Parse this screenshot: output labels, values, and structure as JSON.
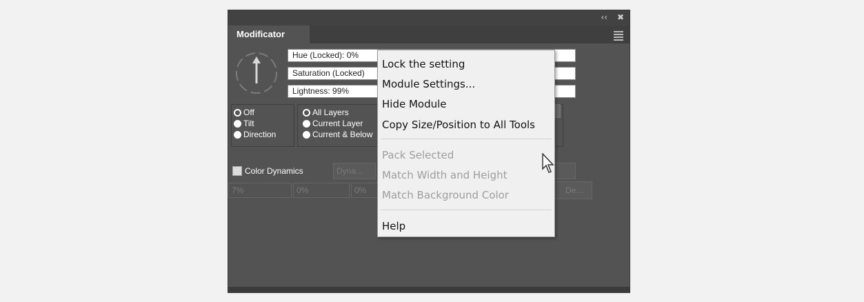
{
  "panel": {
    "title": "Modificator",
    "controls": {
      "collapse": "‹‹",
      "close": "✖"
    }
  },
  "fields": {
    "hue": "Hue (Locked): 0%",
    "saturation": "Saturation (Locked)",
    "lightness": "Lightness: 99%"
  },
  "mode_radios": [
    {
      "label": "Off",
      "selected": true
    },
    {
      "label": "Tilt",
      "selected": false
    },
    {
      "label": "Direction",
      "selected": false
    }
  ],
  "layer_radios": [
    {
      "label": "All Layers",
      "selected": true
    },
    {
      "label": "Current Layer",
      "selected": false
    },
    {
      "label": "Current & Below",
      "selected": false
    }
  ],
  "color_dynamics": {
    "label": "Color Dynamics",
    "checked": false
  },
  "disabled_controls": {
    "dyna_button": "Dyna...",
    "right_button": "De..."
  },
  "percent_boxes": [
    "7%",
    "0%",
    "0%"
  ],
  "context_menu": {
    "items": [
      {
        "label": "Lock the setting",
        "enabled": true
      },
      {
        "label": "Module Settings...",
        "enabled": true
      },
      {
        "label": "Hide Module",
        "enabled": true
      },
      {
        "label": "Copy Size/Position to All Tools",
        "enabled": true
      },
      {
        "label": "Pack Selected",
        "enabled": false
      },
      {
        "label": "Match Width and Height",
        "enabled": false
      },
      {
        "label": "Match Background Color",
        "enabled": false
      },
      {
        "label": "Help",
        "enabled": true
      }
    ]
  }
}
